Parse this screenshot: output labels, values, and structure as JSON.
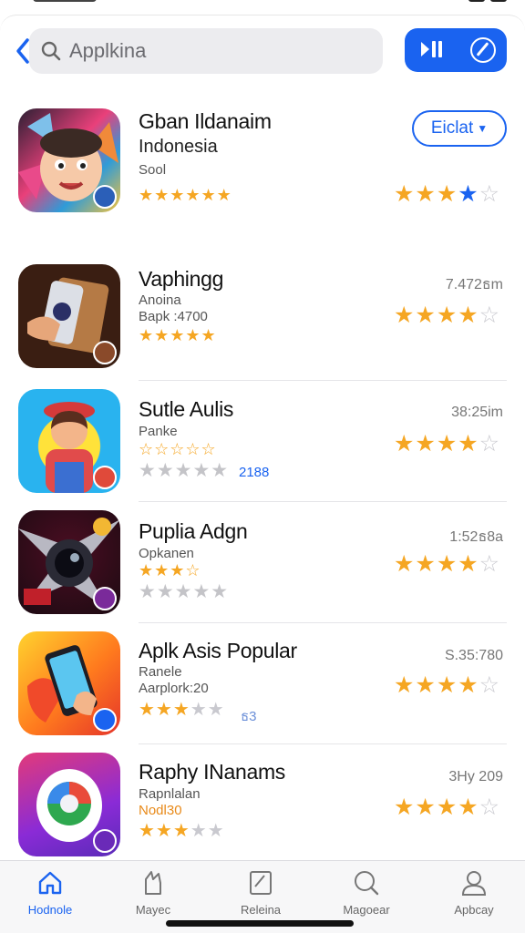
{
  "search": {
    "placeholder": "Applkina"
  },
  "apps": [
    {
      "name": "Gban Ildanaim",
      "line2": "Indonesia",
      "line3": "Sool",
      "small_stars": "★★★★★★",
      "rating_stars": {
        "on": "★★★",
        "blue": "★",
        "off": "☆"
      },
      "get_label": "Eiclat"
    },
    {
      "name": "Vaphingg",
      "line2": "Anoina",
      "line3": "Bapk :4700",
      "small_stars": "★★★★★",
      "meta": "7.472ธm",
      "rating_stars": {
        "on": "★★★★",
        "off": "☆"
      }
    },
    {
      "name": "Sutle Aulis",
      "line2": "Panke",
      "small_stars": "☆☆☆☆☆",
      "gray_stars": "★★★★★",
      "count": "2188",
      "meta": "38:25im",
      "rating_stars": {
        "on": "★★★★",
        "off": "☆"
      }
    },
    {
      "name": "Puplia Adgn",
      "line2": "Opkanen",
      "small_stars": "★★★☆",
      "gray_stars": "★★★★★",
      "meta": "1:52ธ8a",
      "rating_stars": {
        "on": "★★★★",
        "off": "☆"
      }
    },
    {
      "name": "Aplk Asis Popular",
      "line2": "Ranele",
      "line3": "Aarplork:20",
      "small_stars_on": "★★★",
      "small_stars_off": "★★",
      "count": "ธ3",
      "meta": "S.35:780",
      "rating_stars": {
        "on": "★★★★",
        "off": "☆"
      }
    },
    {
      "name": "Raphy INanams",
      "line2": "Rapnlalan",
      "line3": "Nodl30",
      "small_stars_on": "★★★",
      "small_stars_off": "★★",
      "meta": "3Hy 209",
      "rating_stars": {
        "on": "★★★★",
        "off": "☆"
      }
    }
  ],
  "tabs": [
    {
      "label": "Hodnole",
      "icon": "home-icon"
    },
    {
      "label": "Mayec",
      "icon": "games-icon"
    },
    {
      "label": "Releina",
      "icon": "apps-icon"
    },
    {
      "label": "Magoear",
      "icon": "search-icon"
    },
    {
      "label": "Apbcay",
      "icon": "account-icon"
    }
  ],
  "colors": {
    "accent": "#1a63f0",
    "star": "#f5a623",
    "star_off": "#c9c9cf"
  }
}
